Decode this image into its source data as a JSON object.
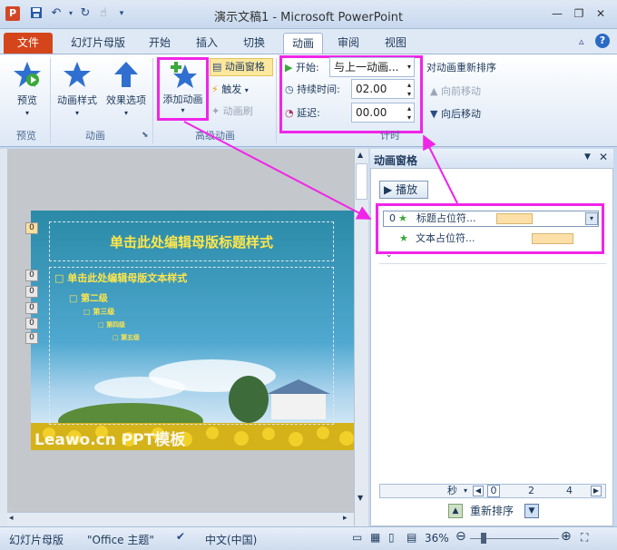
{
  "window": {
    "title": "演示文稿1 - Microsoft PowerPoint",
    "app_icon_letter": "P",
    "qat": [
      "save-icon",
      "undo-icon",
      "redo-icon",
      "touch-icon",
      "customize-qat-icon"
    ],
    "controls": [
      "minimize-icon",
      "restore-icon",
      "close-icon"
    ]
  },
  "tabs": {
    "file": "文件",
    "master": "幻灯片母版",
    "home": "开始",
    "insert": "插入",
    "transitions": "切换",
    "animations": "动画",
    "review": "审阅",
    "view": "视图"
  },
  "ribbon": {
    "preview_btn": "预览",
    "preview_group": "预览",
    "anim_styles_btn": "动画样式",
    "effect_options_btn": "效果选项",
    "animation_group": "动画",
    "add_animation_btn": "添加动画",
    "anim_pane_btn": "动画窗格",
    "trigger_btn": "触发",
    "anim_painter_btn": "动画刷",
    "advanced_group": "高级动画",
    "start_label": "开始:",
    "start_value": "与上一动画...",
    "duration_label": "持续时间:",
    "duration_value": "02.00",
    "delay_label": "延迟:",
    "delay_value": "00.00",
    "timing_group": "计时",
    "reorder_label": "对动画重新排序",
    "move_earlier": "向前移动",
    "move_later": "向后移动"
  },
  "slide": {
    "title_text": "单击此处编辑母版标题样式",
    "levels": [
      "单击此处编辑母版文本样式",
      "第二级",
      "第三级",
      "第四级",
      "第五级"
    ],
    "watermark": "Leawo.cn PPT模板",
    "tags": [
      "0",
      "0",
      "0",
      "0",
      "0",
      "0"
    ]
  },
  "anim_pane": {
    "title": "动画窗格",
    "play_btn": "播放",
    "item1_num": "0",
    "item1_label": "标题占位符...",
    "item2_label": "文本占位符...",
    "timeline_unit": "秒",
    "ticks": [
      "0",
      "2",
      "4"
    ],
    "reorder_label": "重新排序"
  },
  "status": {
    "view": "幻灯片母版",
    "theme": "\"Office 主题\"",
    "language": "中文(中国)",
    "zoom": "36%"
  },
  "colors": {
    "highlight": "#f025e8",
    "file_tab": "#d5451b",
    "slide_title": "#ffe64a"
  }
}
